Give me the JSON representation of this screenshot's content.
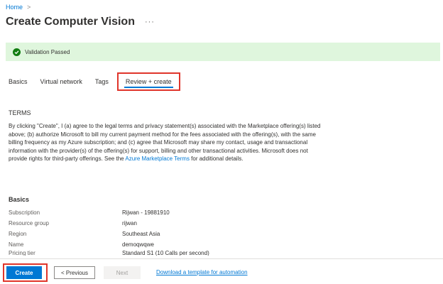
{
  "breadcrumb": {
    "home": "Home",
    "separator": ">"
  },
  "header": {
    "title": "Create Computer Vision",
    "more": "···"
  },
  "validation": {
    "text": "Validation Passed",
    "color": "#107c10"
  },
  "tabs": [
    {
      "label": "Basics"
    },
    {
      "label": "Virtual network"
    },
    {
      "label": "Tags"
    },
    {
      "label": "Review + create"
    }
  ],
  "terms": {
    "heading": "TERMS",
    "body_before": "By clicking \"Create\", I (a) agree to the legal terms and privacy statement(s) associated with the Marketplace offering(s) listed above; (b) authorize Microsoft to bill my current payment method for the fees associated with the offering(s), with the same billing frequency as my Azure subscription; and (c) agree that Microsoft may share my contact, usage and transactional information with the provider(s) of the offering(s) for support, billing and other transactional activities. Microsoft does not provide rights for third-party offerings. See the ",
    "link": "Azure Marketplace Terms",
    "body_after": " for additional details."
  },
  "basics": {
    "title": "Basics",
    "rows": [
      {
        "key": "Subscription",
        "value": "Rijwan - 19881910"
      },
      {
        "key": "Resource group",
        "value": "rijwan"
      },
      {
        "key": "Region",
        "value": "Southeast Asia"
      },
      {
        "key": "Name",
        "value": "demoqwqwe"
      },
      {
        "key": "Pricing tier",
        "value": "Standard S1 (10 Calls per second)"
      }
    ]
  },
  "footer": {
    "create": "Create",
    "previous": "< Previous",
    "next": "Next",
    "download": "Download a template for automation"
  },
  "colors": {
    "accent": "#0078d4",
    "highlight": "#e0352b",
    "success_bg": "#dff6dd"
  }
}
